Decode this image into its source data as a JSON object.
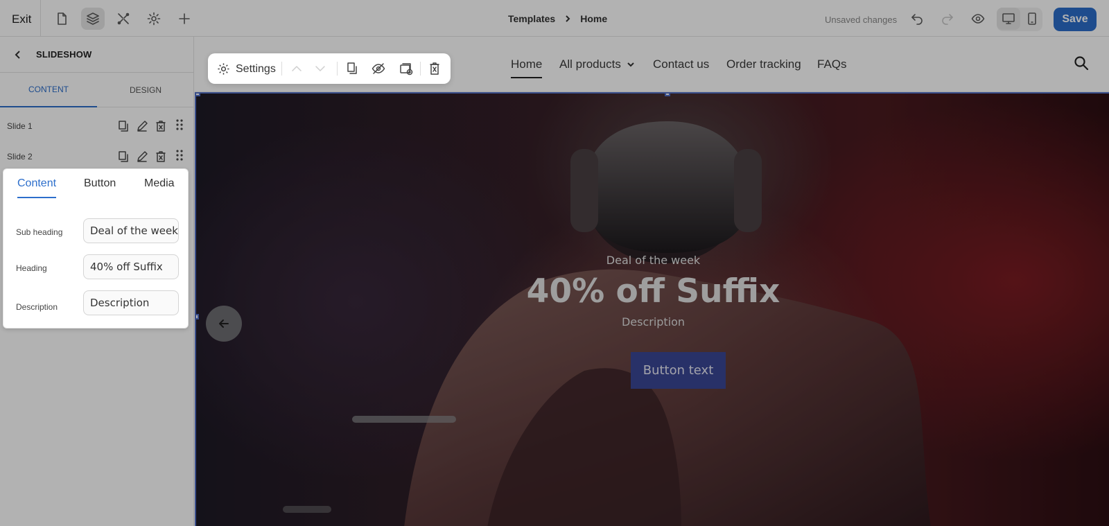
{
  "topbar": {
    "exit_label": "Exit",
    "breadcrumb": [
      "Templates",
      "Home"
    ],
    "status": "Unsaved changes",
    "save_label": "Save"
  },
  "sidebar": {
    "title": "SLIDESHOW",
    "tabs": [
      "CONTENT",
      "DESIGN"
    ],
    "slides": [
      "Slide 1",
      "Slide 2"
    ]
  },
  "panel": {
    "tabs": [
      "Content",
      "Button",
      "Media"
    ],
    "fields": [
      {
        "label": "Sub heading",
        "value": "Deal of the week"
      },
      {
        "label": "Heading",
        "value": "40% off Suffix"
      },
      {
        "label": "Description",
        "value": "Description"
      }
    ]
  },
  "section_toolbar": {
    "settings_label": "Settings"
  },
  "store_nav": {
    "items": [
      "Home",
      "All products",
      "Contact us",
      "Order tracking",
      "FAQs"
    ]
  },
  "hero": {
    "subheading": "Deal of the week",
    "heading": "40% off Suffix",
    "description": "Description",
    "button_label": "Button text"
  },
  "colors": {
    "accent": "#2c6ecb",
    "hero_button": "#3a4796"
  }
}
